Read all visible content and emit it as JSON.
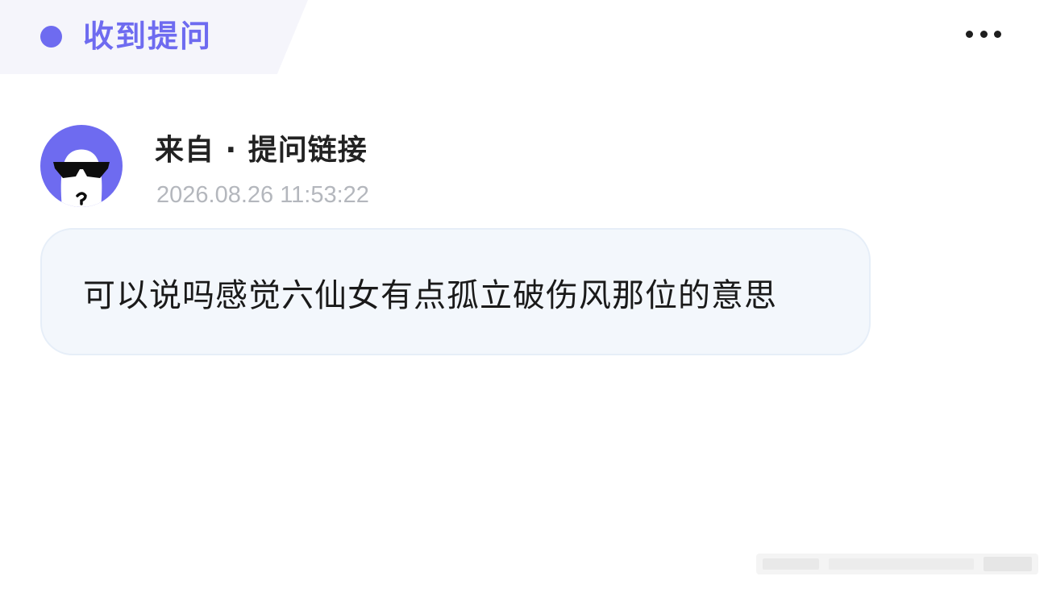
{
  "header": {
    "title": "收到提问",
    "accent_color": "#6e6bf0",
    "more_icon": "more-horizontal-icon"
  },
  "message": {
    "avatar_icon": "sunglasses-avatar-icon",
    "avatar_color": "#6e6bf0",
    "sender": "来自 · 提问链接",
    "timestamp": "2026.08.26 11:53:22",
    "question": "可以说吗感觉六仙女有点孤立破伤风那位的意思"
  }
}
